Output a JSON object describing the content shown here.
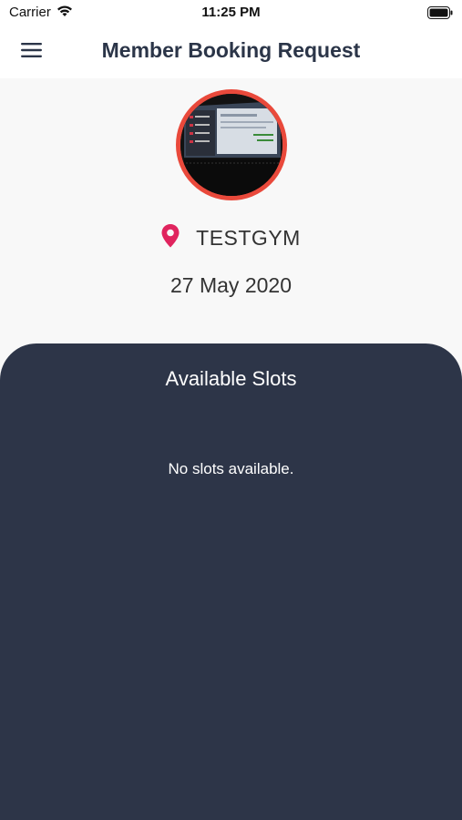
{
  "status_bar": {
    "carrier": "Carrier",
    "time": "11:25 PM",
    "wifi_icon": "wifi-icon",
    "battery_icon": "battery-icon"
  },
  "header": {
    "menu_icon": "hamburger-menu-icon",
    "title": "Member Booking Request"
  },
  "profile": {
    "image_description": "profile-photo"
  },
  "location": {
    "icon": "location-pin-icon",
    "name": "TESTGYM",
    "icon_color": "#e0245e"
  },
  "date": "27 May 2020",
  "slots": {
    "title": "Available Slots",
    "empty_message": "No slots available.",
    "panel_color": "#2d3548"
  },
  "colors": {
    "accent_ring": "#e9493b",
    "title_text": "#2b3548"
  }
}
